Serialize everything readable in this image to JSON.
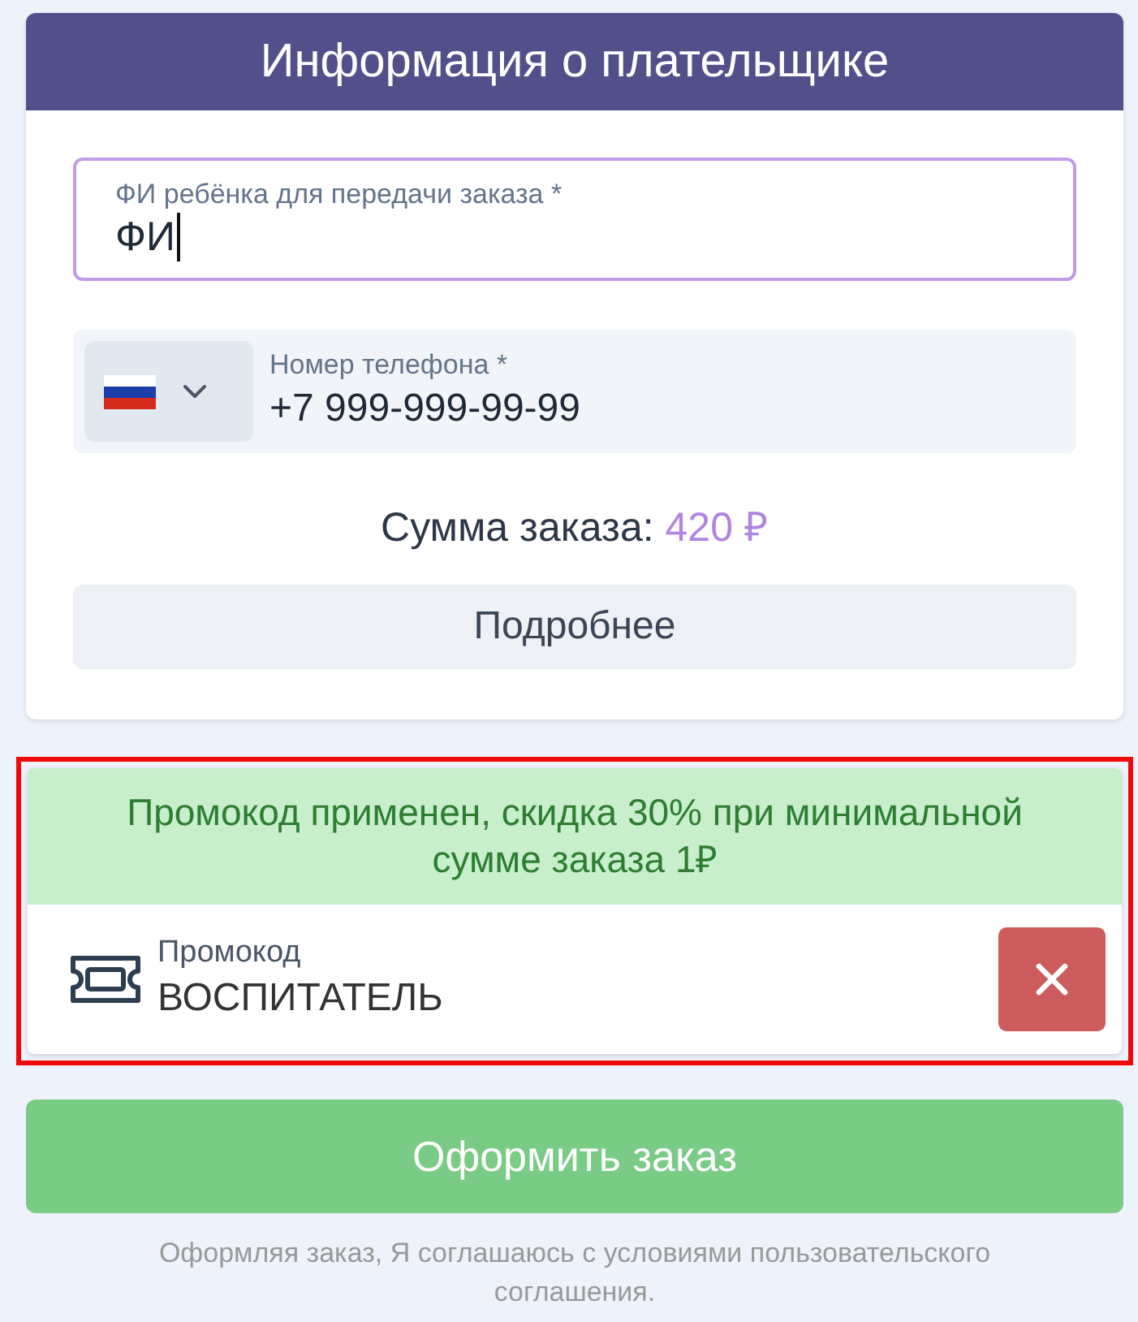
{
  "header": {
    "title": "Информация о плательщике"
  },
  "fields": [
    {
      "kind": "text",
      "label": "ФИ ребёнка для передачи заказа *",
      "value": "ФИ",
      "focused": true
    },
    {
      "kind": "phone",
      "label": "Номер телефона *",
      "value": "+7 999-999-99-99",
      "focused": false
    }
  ],
  "order_sum": {
    "label": "Сумма заказа:",
    "amount": "420 ₽"
  },
  "details_button": "Подробнее",
  "promo": {
    "highlighted": true,
    "applied": true,
    "message": "Промокод применен, скидка 30% при минимальной сумме заказа 1₽",
    "label": "Промокод",
    "value": "ВОСПИТАТЕЛЬ"
  },
  "submit_button": "Оформить заказ",
  "agreement": "Оформляя заказ, Я соглашаюсь с условиями пользовательского соглашения."
}
